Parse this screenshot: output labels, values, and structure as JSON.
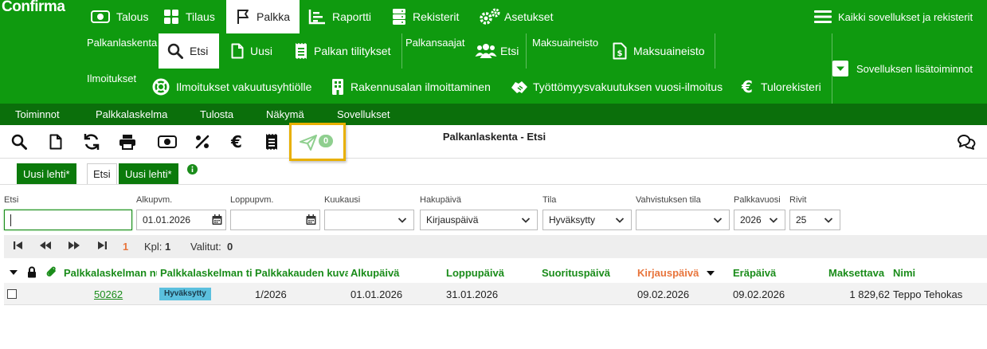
{
  "app": {
    "logo": "Confirma"
  },
  "main_tabs": [
    {
      "label": "Talous",
      "icon": "money-icon"
    },
    {
      "label": "Tilaus",
      "icon": "grid-icon"
    },
    {
      "label": "Palkka",
      "icon": "flag-icon"
    },
    {
      "label": "Raportti",
      "icon": "report-icon"
    },
    {
      "label": "Rekisterit",
      "icon": "database-icon"
    },
    {
      "label": "Asetukset",
      "icon": "gears-icon"
    }
  ],
  "all_apps_label": "Kaikki sovellukset ja rekisterit",
  "app_extra_label": "Sovelluksen lisätoiminnot",
  "groups": {
    "palkanlaskenta": "Palkanlaskenta",
    "palkansaajat": "Palkansaajat",
    "maksuaineisto": "Maksuaineisto",
    "ilmoitukset": "Ilmoitukset"
  },
  "sub_items": {
    "etsi": "Etsi",
    "uusi": "Uusi",
    "tilitykset": "Palkan tilitykset",
    "saajat_etsi": "Etsi",
    "maksuaineisto": "Maksuaineisto",
    "vakuutus": "Ilmoitukset vakuutusyhtiölle",
    "rakennus": "Rakennusalan ilmoittaminen",
    "tyottomyys": "Työttömyysvakuutuksen vuosi-ilmoitus",
    "tulorekisteri": "Tulorekisteri"
  },
  "menu": [
    "Toiminnot",
    "Palkkalaskelma",
    "Tulosta",
    "Näkymä",
    "Sovellukset"
  ],
  "toolbar": {
    "title": "Palkanlaskenta - Etsi",
    "send_badge": "0"
  },
  "page_tabs": [
    "Uusi lehti*",
    "Etsi",
    "Uusi lehti*"
  ],
  "filters": {
    "etsi": {
      "label": "Etsi",
      "value": ""
    },
    "alkupvm": {
      "label": "Alkupvm.",
      "value": "01.01.2026"
    },
    "loppupvm": {
      "label": "Loppupvm.",
      "value": ""
    },
    "kuukausi": {
      "label": "Kuukausi",
      "value": ""
    },
    "hakupaiva": {
      "label": "Hakupäivä",
      "value": "Kirjauspäivä"
    },
    "tila": {
      "label": "Tila",
      "value": "Hyväksytty"
    },
    "vahvistus": {
      "label": "Vahvistuksen tila",
      "value": ""
    },
    "palkkavuosi": {
      "label": "Palkkavuosi",
      "value": "2026"
    },
    "rivit": {
      "label": "Rivit",
      "value": "25"
    }
  },
  "pager": {
    "page": "1",
    "kpl_label": "Kpl:",
    "kpl": "1",
    "valitut_label": "Valitut:",
    "valitut": "0"
  },
  "table": {
    "columns": [
      "Palkkalaskelman numero",
      "Palkkalaskelman tila",
      "Palkkakauden kuvaus",
      "Alkupäivä",
      "Loppupäivä",
      "Suorituspäivä",
      "Kirjauspäivä",
      "Eräpäivä",
      "Maksettava",
      "Nimi"
    ],
    "rows": [
      {
        "numero": "50262",
        "tila": "Hyväksytty",
        "kausi": "1/2026",
        "alku": "01.01.2026",
        "loppu": "31.01.2026",
        "suoritus": "",
        "kirjaus": "09.02.2026",
        "era": "09.02.2026",
        "maksettava": "1 829,62",
        "nimi": "Teppo Tehokas"
      }
    ]
  },
  "colors": {
    "header_green": "#0f9a0f",
    "menu_green": "#0b6f0b",
    "column_green": "#1a8c1a",
    "sorted_orange": "#e8743b",
    "status_blue": "#5bc0de",
    "highlight_yellow": "#e8b000"
  }
}
